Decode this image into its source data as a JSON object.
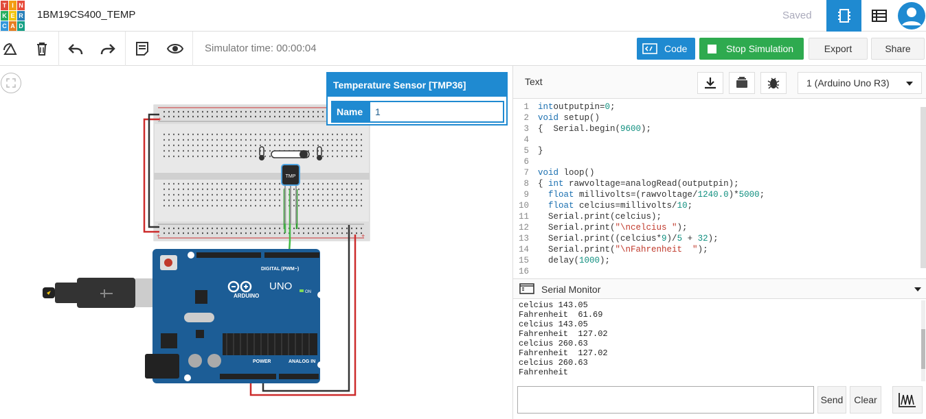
{
  "app": {
    "logo_letters": [
      "T",
      "I",
      "N",
      "K",
      "E",
      "R",
      "C",
      "A",
      "D"
    ],
    "project_name": "1BM19CS400_TEMP",
    "save_status": "Saved"
  },
  "colors": {
    "accent_blue": "#1f8ad1",
    "stop_green": "#2eaa4f",
    "board_blue": "#1c5d96"
  },
  "toolbar": {
    "icons": [
      "rotate-icon",
      "delete-icon",
      "undo-icon",
      "redo-icon",
      "notes-icon",
      "visibility-icon"
    ],
    "simulator_time": "Simulator time: 00:00:04",
    "code_label": "Code",
    "stop_label": "Stop Simulation",
    "export_label": "Export",
    "share_label": "Share"
  },
  "inspector": {
    "title": "Temperature Sensor [TMP36]",
    "name_label": "Name",
    "name_value": "1"
  },
  "code_panel": {
    "mode": "Text",
    "device": "1 (Arduino Uno R3)",
    "lines": [
      {
        "n": "1",
        "parts": [
          [
            "kw",
            "int"
          ],
          [
            "",
            "outputpin="
          ],
          [
            "num",
            "0"
          ],
          [
            "",
            ";"
          ]
        ]
      },
      {
        "n": "2",
        "parts": [
          [
            "kw",
            "void"
          ],
          [
            "",
            " setup()"
          ]
        ]
      },
      {
        "n": "3",
        "parts": [
          [
            "",
            "{  Serial.begin("
          ],
          [
            "num",
            "9600"
          ],
          [
            "",
            ");"
          ]
        ]
      },
      {
        "n": "4",
        "parts": []
      },
      {
        "n": "5",
        "parts": [
          [
            "",
            "}"
          ]
        ]
      },
      {
        "n": "6",
        "parts": []
      },
      {
        "n": "7",
        "parts": [
          [
            "kw",
            "void"
          ],
          [
            "",
            " loop()"
          ]
        ]
      },
      {
        "n": "8",
        "parts": [
          [
            "",
            "{ "
          ],
          [
            "kw",
            "int"
          ],
          [
            "",
            " rawvoltage=analogRead(outputpin);"
          ]
        ]
      },
      {
        "n": "9",
        "parts": [
          [
            "",
            "  "
          ],
          [
            "kw",
            "float"
          ],
          [
            "",
            " millivolts=(rawvoltage/"
          ],
          [
            "num",
            "1240.0"
          ],
          [
            "",
            ")*"
          ],
          [
            "num",
            "5000"
          ],
          [
            "",
            ";"
          ]
        ]
      },
      {
        "n": "10",
        "parts": [
          [
            "",
            "  "
          ],
          [
            "kw",
            "float"
          ],
          [
            "",
            " celcius=millivolts/"
          ],
          [
            "num",
            "10"
          ],
          [
            "",
            ";"
          ]
        ]
      },
      {
        "n": "11",
        "parts": [
          [
            "",
            "  Serial.print(celcius);"
          ]
        ]
      },
      {
        "n": "12",
        "parts": [
          [
            "",
            "  Serial.print("
          ],
          [
            "str",
            "\"\\ncelcius \""
          ],
          [
            "",
            ");"
          ]
        ]
      },
      {
        "n": "13",
        "parts": [
          [
            "",
            "  Serial.print((celcius*"
          ],
          [
            "num",
            "9"
          ],
          [
            "",
            ")/"
          ],
          [
            "num",
            "5"
          ],
          [
            "",
            " + "
          ],
          [
            "num",
            "32"
          ],
          [
            "",
            ");"
          ]
        ]
      },
      {
        "n": "14",
        "parts": [
          [
            "",
            "  Serial.print("
          ],
          [
            "str",
            "\"\\nFahrenheit  \""
          ],
          [
            "",
            ");"
          ]
        ]
      },
      {
        "n": "15",
        "parts": [
          [
            "",
            "  delay("
          ],
          [
            "num",
            "1000"
          ],
          [
            "",
            ");"
          ]
        ]
      },
      {
        "n": "16",
        "parts": []
      }
    ]
  },
  "serial_monitor": {
    "title": "Serial Monitor",
    "output": "celcius 143.05\nFahrenheit  61.69\ncelcius 143.05\nFahrenheit  127.02\ncelcius 260.63\nFahrenheit  127.02\ncelcius 260.63\nFahrenheit",
    "input_value": "",
    "send_label": "Send",
    "clear_label": "Clear"
  },
  "circuit": {
    "sensor_label": "TMP",
    "board_brand": "ARDUINO",
    "board_model": "UNO",
    "digital_header": "DIGITAL (PWM~)",
    "power_header": "POWER",
    "analog_header": "ANALOG IN",
    "on_label": "ON"
  }
}
